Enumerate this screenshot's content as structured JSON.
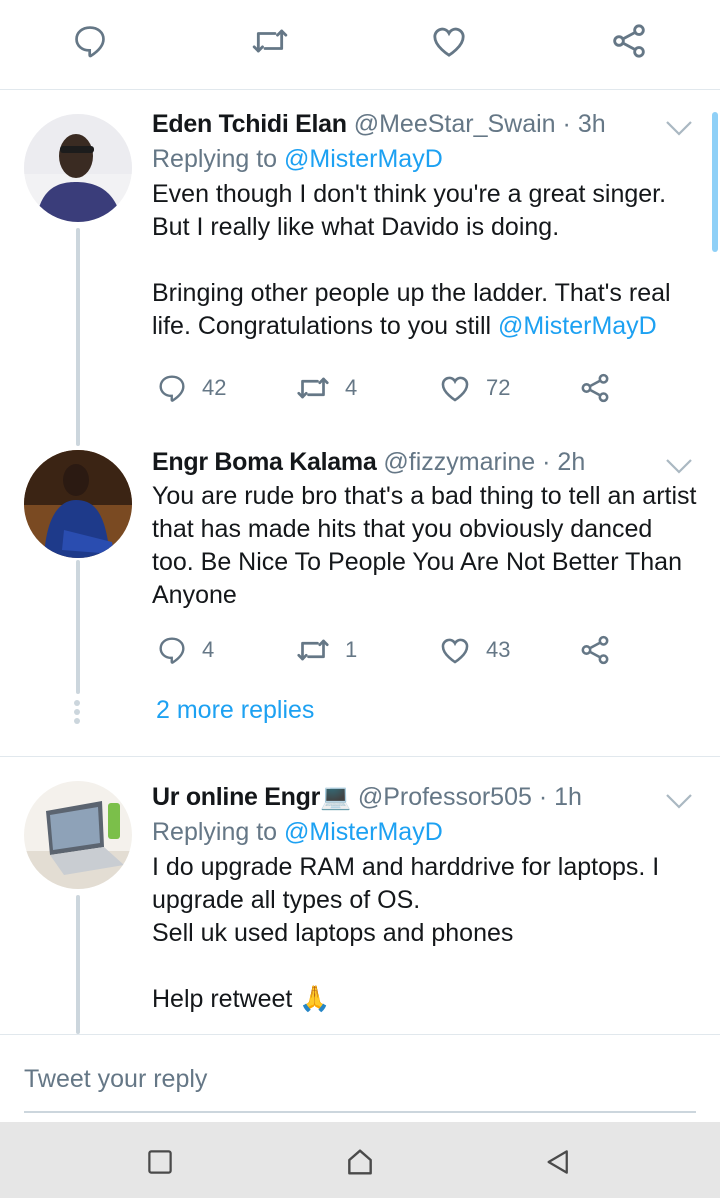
{
  "colors": {
    "accent": "#1da1f2",
    "secondary_text": "#657786",
    "primary_text": "#14171a",
    "thread_line": "#ccd6dd"
  },
  "top_actions": [
    "reply-icon",
    "retweet-icon",
    "like-icon",
    "share-icon"
  ],
  "tweets": [
    {
      "name": "Eden Tchidi Elan",
      "handle": "@MeeStar_Swain",
      "dot": "·",
      "time": "3h",
      "reply_prefix": "Replying to",
      "reply_to": "@MisterMayD",
      "body_lines": [
        "Even though I don't think you're a great singer.",
        "But I really like what Davido is doing.",
        "",
        "Bringing other people up the ladder. That's real",
        "life. Congratulations to you still "
      ],
      "body_mention": "@MisterMayD",
      "replies": "42",
      "retweets": "4",
      "likes": "72"
    },
    {
      "name": "Engr Boma Kalama",
      "handle": "@fizzymarine",
      "dot": "·",
      "time": "2h",
      "body_lines": [
        "You are rude bro that's a bad thing to tell an artist",
        "that has made hits that you obviously danced",
        "too. Be Nice To People You Are Not Better Than",
        "Anyone"
      ],
      "replies": "4",
      "retweets": "1",
      "likes": "43"
    },
    {
      "name": "Ur online Engr💻",
      "handle": "@Professor505",
      "dot": "·",
      "time": "1h",
      "reply_prefix": "Replying to",
      "reply_to": "@MisterMayD",
      "body_lines": [
        "I do upgrade RAM and harddrive for laptops. I",
        "upgrade all types of OS.",
        "Sell uk used laptops and phones",
        "",
        "Help retweet 🙏"
      ]
    }
  ],
  "more_replies": "2 more replies",
  "composer": {
    "placeholder": "Tweet your reply"
  },
  "nav": [
    "recents-square-icon",
    "home-icon",
    "back-triangle-icon"
  ]
}
